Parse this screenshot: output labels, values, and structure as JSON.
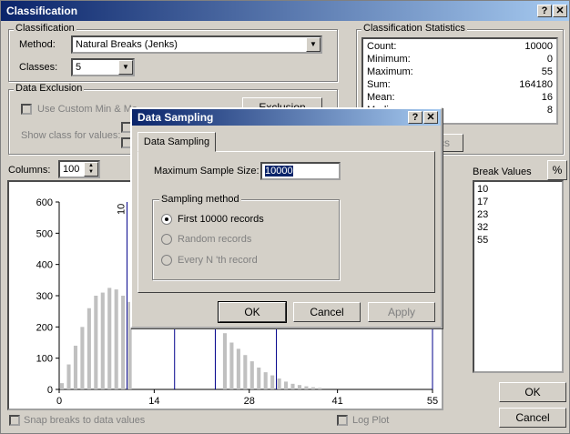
{
  "window": {
    "title": "Classification",
    "help_btn": "?",
    "close_btn": "✕"
  },
  "classification": {
    "group_label": "Classification",
    "method_label": "Method:",
    "method_value": "Natural Breaks (Jenks)",
    "classes_label": "Classes:",
    "classes_value": "5"
  },
  "exclusion": {
    "group_label": "Data Exclusion",
    "use_custom_label": "Use Custom Min & Ma",
    "show_class_label": "Show class for values:",
    "exclusion_btn": "Exclusion"
  },
  "stats": {
    "group_label": "Classification Statistics",
    "rows": [
      {
        "k": "Count:",
        "v": "10000"
      },
      {
        "k": "Minimum:",
        "v": "0"
      },
      {
        "k": "Maximum:",
        "v": "55"
      },
      {
        "k": "Sum:",
        "v": "164180"
      },
      {
        "k": "Mean:",
        "v": "16"
      },
      {
        "k": "Median:",
        "v": "8"
      }
    ],
    "stats_btn": "Statistics"
  },
  "columns": {
    "label": "Columns:",
    "value": "100"
  },
  "break_values": {
    "label": "Break Values",
    "pct_btn": "%",
    "values": [
      "10",
      "17",
      "23",
      "32",
      "55"
    ]
  },
  "bottom": {
    "snap_label": "Snap breaks to data values",
    "log_label": "Log Plot",
    "ok": "OK",
    "cancel": "Cancel"
  },
  "dialog": {
    "title": "Data Sampling",
    "help_btn": "?",
    "close_btn": "✕",
    "tab": "Data Sampling",
    "max_label": "Maximum Sample Size:",
    "max_value": "10000",
    "sampling_group": "Sampling method",
    "opt1": "First 10000 records",
    "opt2": "Random records",
    "opt3": "Every N 'th record",
    "ok": "OK",
    "cancel": "Cancel",
    "apply": "Apply"
  },
  "chart_data": {
    "type": "bar",
    "ylim": [
      0,
      600
    ],
    "xlim": [
      0,
      55
    ],
    "yticks": [
      "0",
      "100",
      "200",
      "300",
      "400",
      "500",
      "600"
    ],
    "xticks": [
      "0",
      "14",
      "28",
      "41",
      "55"
    ],
    "break_label": "10",
    "breaks": [
      10,
      17,
      23,
      32,
      55
    ],
    "x": [
      0,
      1,
      2,
      3,
      4,
      5,
      6,
      7,
      8,
      9,
      10,
      24,
      25,
      26,
      27,
      28,
      29,
      30,
      31,
      32,
      33,
      34,
      35,
      36,
      37,
      38
    ],
    "values": [
      20,
      80,
      140,
      200,
      260,
      300,
      310,
      325,
      320,
      300,
      280,
      180,
      150,
      130,
      110,
      90,
      70,
      55,
      45,
      35,
      25,
      18,
      14,
      10,
      7,
      5
    ]
  }
}
